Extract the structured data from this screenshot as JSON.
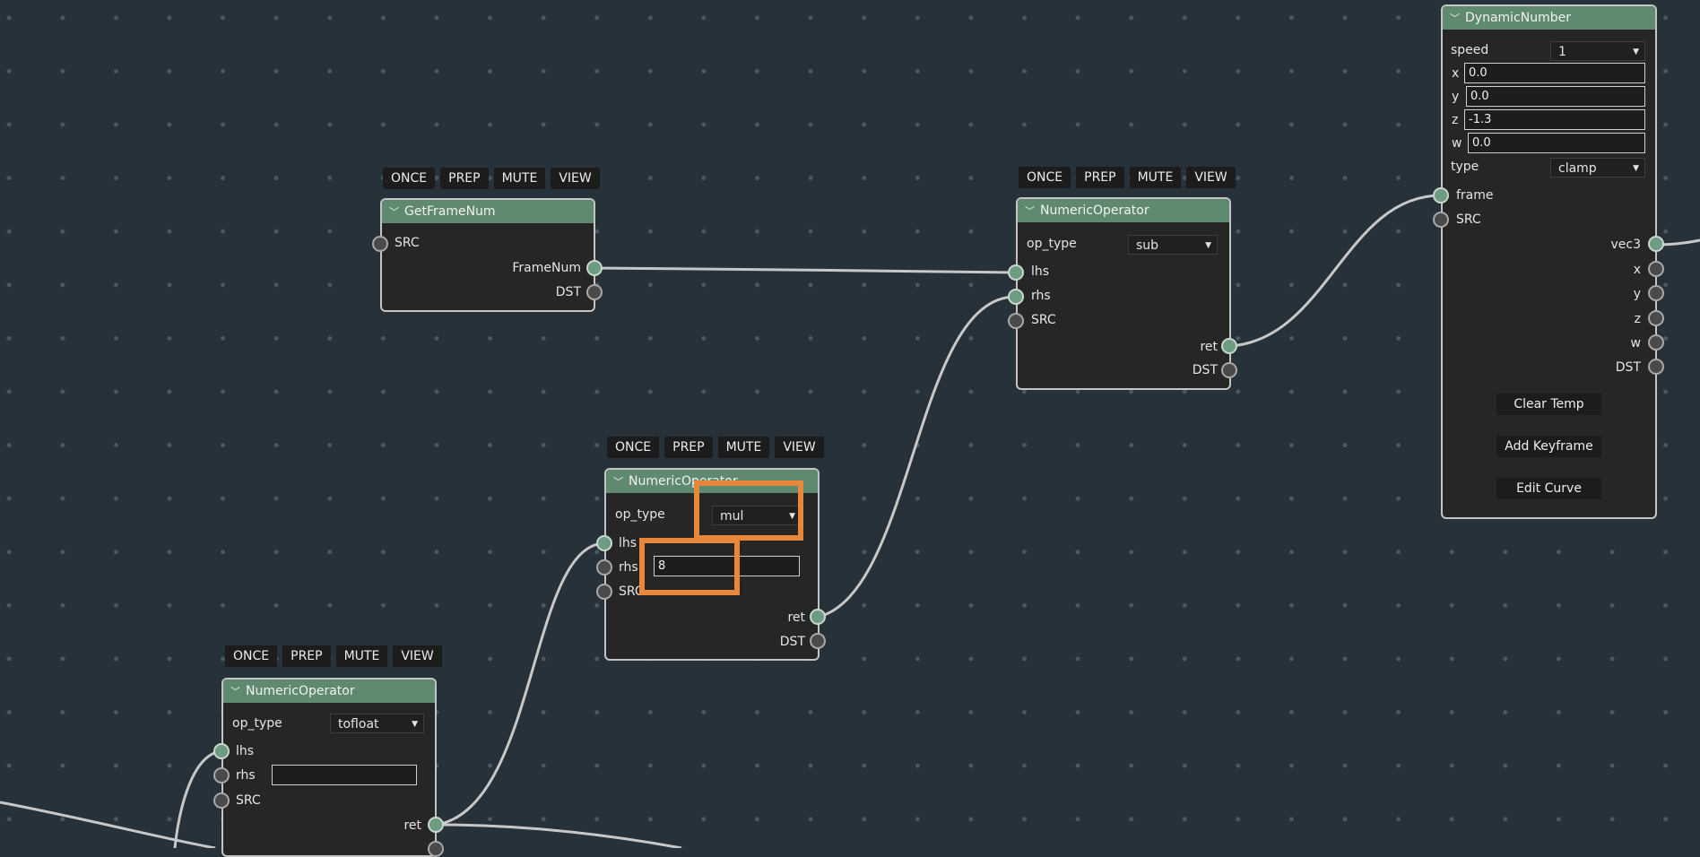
{
  "toolbar_buttons": [
    "ONCE",
    "PREP",
    "MUTE",
    "VIEW"
  ],
  "colors": {
    "background": "#26313a",
    "node_body": "#262626",
    "node_header": "#5f8a6f",
    "node_border": "#c4c4c4",
    "port_connected": "#6d9c82",
    "wire": "#c8c8c8",
    "highlight": "#e8873a"
  },
  "icons": {
    "collapse": "chevron-down-icon",
    "dropdown": "caret-down-icon"
  },
  "caret_glyph": "▼",
  "chevron_glyph": "╲╱",
  "get_frame_num": {
    "title": "GetFrameNum",
    "ports": {
      "src": "SRC",
      "framenum": "FrameNum",
      "dst": "DST"
    }
  },
  "numeric_sub": {
    "title": "NumericOperator",
    "op_type_label": "op_type",
    "op_type_value": "sub",
    "ports": {
      "lhs": "lhs",
      "rhs": "rhs",
      "src": "SRC",
      "ret": "ret",
      "dst": "DST"
    }
  },
  "numeric_mul": {
    "title": "NumericOperator",
    "op_type_label": "op_type",
    "op_type_value": "mul",
    "rhs_value": "8",
    "ports": {
      "lhs": "lhs",
      "rhs": "rhs",
      "src": "SRC",
      "ret": "ret",
      "dst": "DST"
    }
  },
  "numeric_tofloat": {
    "title": "NumericOperator",
    "op_type_label": "op_type",
    "op_type_value": "tofloat",
    "rhs_value": "",
    "ports": {
      "lhs": "lhs",
      "rhs": "rhs",
      "src": "SRC",
      "ret": "ret"
    }
  },
  "dynamic_number": {
    "title": "DynamicNumber",
    "speed_label": "speed",
    "speed_value": "1",
    "x_label": "x",
    "x_value": "0.0",
    "y_label": "y",
    "y_value": "0.0",
    "z_label": "z",
    "z_value": "-1.3",
    "w_label": "w",
    "w_value": "0.0",
    "type_label": "type",
    "type_value": "clamp",
    "ports": {
      "frame": "frame",
      "src": "SRC",
      "vec3": "vec3",
      "x": "x",
      "y": "y",
      "z": "z",
      "w": "w",
      "dst": "DST"
    },
    "buttons": {
      "clear_temp": "Clear Temp",
      "add_keyframe": "Add Keyframe",
      "edit_curve": "Edit Curve"
    }
  }
}
